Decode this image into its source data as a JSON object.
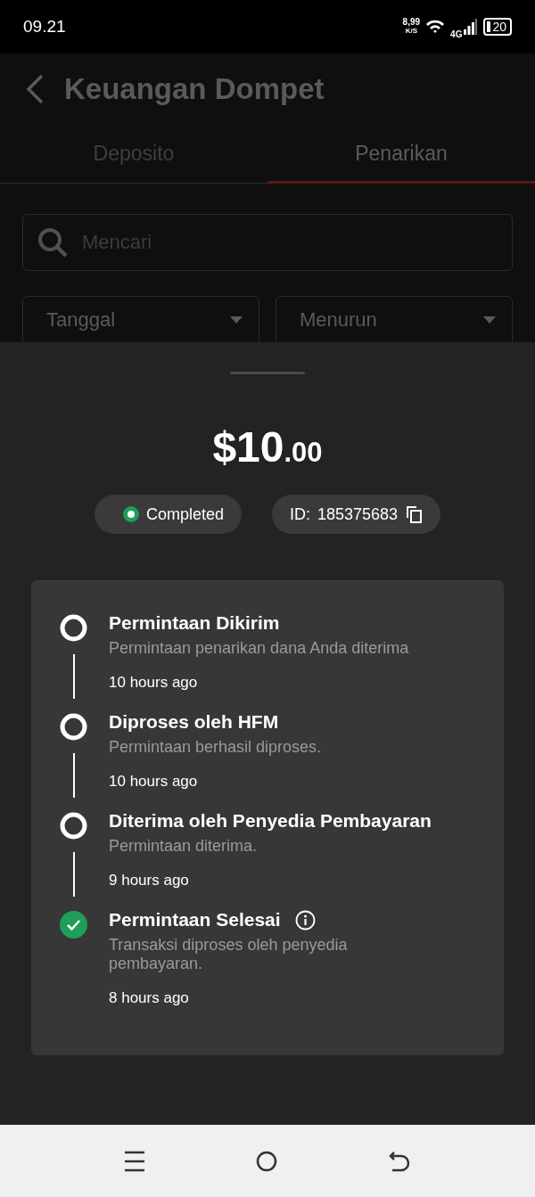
{
  "status_bar": {
    "time": "09.21",
    "speed_value": "8,99",
    "speed_unit": "K/S",
    "network": "4G",
    "battery": "20"
  },
  "header": {
    "title": "Keuangan Dompet"
  },
  "tabs": [
    {
      "label": "Deposito",
      "selected": false
    },
    {
      "label": "Penarikan",
      "selected": true
    }
  ],
  "search": {
    "placeholder": "Mencari"
  },
  "filters": [
    {
      "value": "Tanggal"
    },
    {
      "value": "Menurun"
    }
  ],
  "sheet": {
    "amount_main": "$10",
    "amount_fraction": ".00",
    "status": "Completed",
    "id_label": "ID:",
    "id_value": "185375683",
    "steps": [
      {
        "kind": "pending",
        "title": "Permintaan Dikirim",
        "description": "Permintaan penarikan dana Anda diterima",
        "time": "10 hours ago",
        "info": false
      },
      {
        "kind": "pending",
        "title": "Diproses oleh HFM",
        "description": "Permintaan berhasil diproses.",
        "time": "10 hours ago",
        "info": false
      },
      {
        "kind": "pending",
        "title": "Diterima oleh Penyedia Pembayaran",
        "description": "Permintaan diterima.",
        "time": "9 hours ago",
        "info": false
      },
      {
        "kind": "done",
        "title": "Permintaan Selesai",
        "description": "Transaksi diproses oleh penyedia pembayaran.",
        "time": "8 hours ago",
        "info": true
      }
    ]
  }
}
